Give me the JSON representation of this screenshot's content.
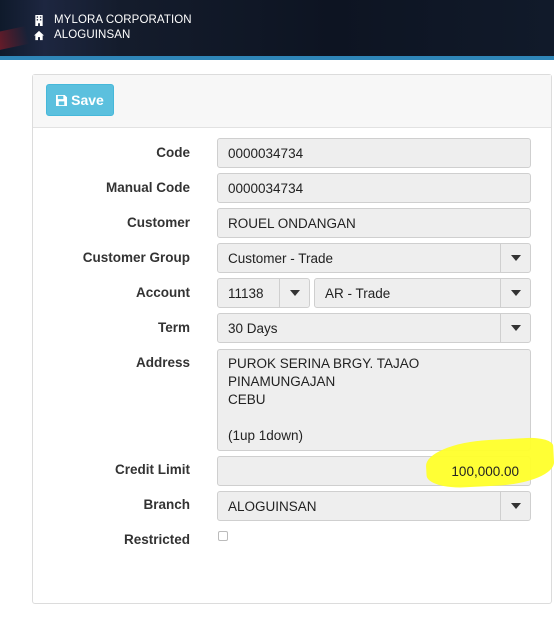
{
  "header": {
    "company": "MYLORA CORPORATION",
    "branch": "ALOGUINSAN",
    "company_icon": "building-icon",
    "branch_icon": "home-icon"
  },
  "toolbar": {
    "save_label": "Save",
    "save_icon": "floppy-disk-icon",
    "save_color": "#5bc0de"
  },
  "form": {
    "code": {
      "label": "Code",
      "value": "0000034734"
    },
    "manual_code": {
      "label": "Manual Code",
      "value": "0000034734"
    },
    "customer": {
      "label": "Customer",
      "value": "ROUEL ONDANGAN"
    },
    "customer_group": {
      "label": "Customer Group",
      "value": "Customer - Trade"
    },
    "account": {
      "label": "Account",
      "code": "11138",
      "name": "AR - Trade"
    },
    "term": {
      "label": "Term",
      "value": "30 Days"
    },
    "address": {
      "label": "Address",
      "lines": [
        "PUROK SERINA BRGY. TAJAO PINAMUNGAJAN",
        "CEBU",
        "",
        "(1up 1down)"
      ]
    },
    "credit_limit": {
      "label": "Credit Limit",
      "value": "100,000.00",
      "highlight_color": "#ffff2a"
    },
    "branch": {
      "label": "Branch",
      "value": "ALOGUINSAN"
    },
    "restricted": {
      "label": "Restricted",
      "checked": false
    }
  }
}
